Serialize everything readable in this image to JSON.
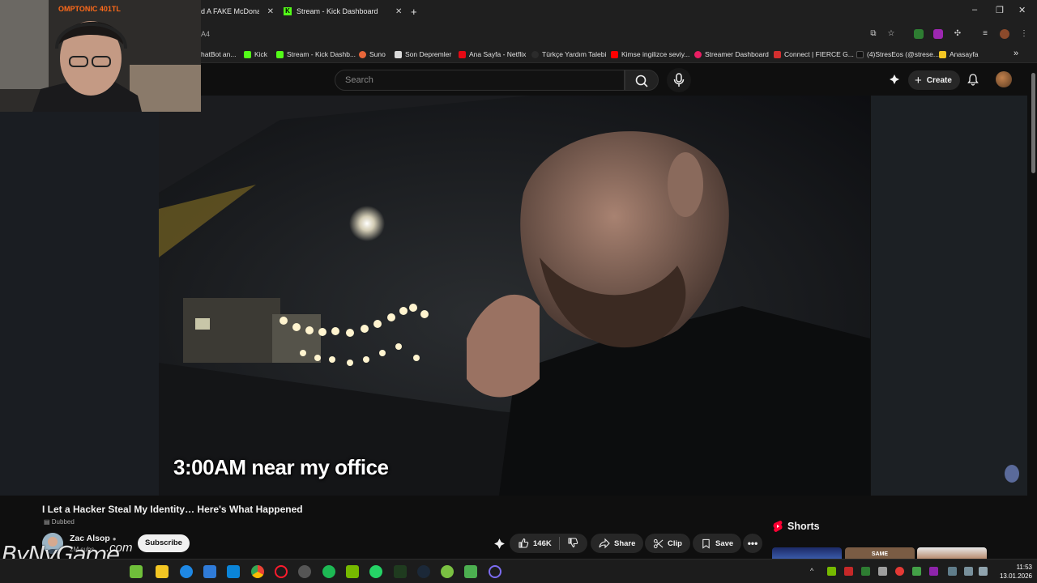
{
  "browser": {
    "tabs": [
      {
        "title": "d A FAKE McDonald"
      },
      {
        "title": "Stream - Kick Dashboard"
      }
    ],
    "new_tab": "+",
    "address": "A4",
    "bookmarks": [
      {
        "label": "hatBot an...",
        "color": "#444444"
      },
      {
        "label": "Kick",
        "color": "#53fc18"
      },
      {
        "label": "Stream - Kick Dashb...",
        "color": "#53fc18"
      },
      {
        "label": "Suno",
        "color": "#e8663a"
      },
      {
        "label": "Son Depremler",
        "color": "#d9d9d9"
      },
      {
        "label": "Ana Sayfa - Netflix",
        "color": "#e50914"
      },
      {
        "label": "Türkçe Yardım Talebi",
        "color": "#2b2b2b"
      },
      {
        "label": "Kimse ingilizce seviy...",
        "color": "#ff0000"
      },
      {
        "label": "Streamer Dashboard",
        "color": "#e91e63"
      },
      {
        "label": "Connect | FIERCE G...",
        "color": "#d32f2f"
      },
      {
        "label": "(4)StresEos (@strese...",
        "color": "#111111"
      },
      {
        "label": "Anasayfa",
        "color": "#f3c623"
      }
    ],
    "overflow": "»"
  },
  "webcam": {
    "label": "OMPTONIC 401TL"
  },
  "youtube": {
    "search_placeholder": "Search",
    "create_label": "Create",
    "video": {
      "caption": "3:00AM near my office",
      "title": "I Let a Hacker Steal My Identity… Here's What Happened",
      "dubbed": "Dubbed",
      "channel": "Zac Alsop",
      "subscribers": "2M subs",
      "subscribe_label": "Subscribe",
      "likes": "146K",
      "share_label": "Share",
      "clip_label": "Clip",
      "save_label": "Save"
    },
    "shorts_label": "Shorts",
    "short_thumb_text": "SAME"
  },
  "watermark": {
    "brand": "ByNyGame",
    "suffix": ".com"
  },
  "taskbar": {
    "time": "11:53",
    "date": "13.01.2026"
  },
  "colors": {
    "kick": "#53fc18",
    "youtube_red": "#ff0033",
    "webcam_label": "#ff6a1a"
  }
}
